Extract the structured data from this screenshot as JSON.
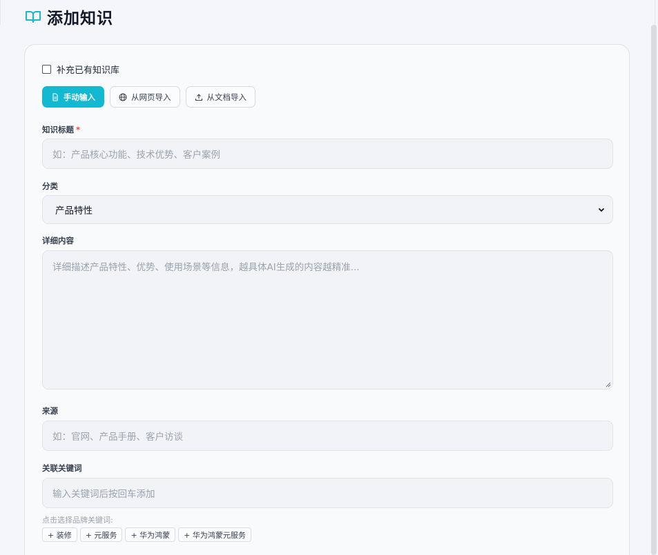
{
  "header": {
    "title": "添加知识",
    "icon": "book-open-icon",
    "accent": "#14b8d1"
  },
  "form": {
    "supplement_label": "补充已有知识库",
    "modes": [
      {
        "label": "手动输入",
        "icon": "file-icon",
        "active": true
      },
      {
        "label": "从网页导入",
        "icon": "globe-icon",
        "active": false
      },
      {
        "label": "从文档导入",
        "icon": "upload-icon",
        "active": false
      }
    ],
    "title_label": "知识标题",
    "title_required": "*",
    "title_placeholder": "如：产品核心功能、技术优势、客户案例",
    "category_label": "分类",
    "category_value": "产品特性",
    "content_label": "详细内容",
    "content_placeholder": "详细描述产品特性、优势、使用场景等信息，越具体AI生成的内容越精准...",
    "source_label": "来源",
    "source_placeholder": "如：官网、产品手册、客户访谈",
    "keywords_label": "关联关键词",
    "keywords_placeholder": "输入关键词后按回车添加",
    "brand_hint": "点击选择品牌关键词:",
    "brand_keywords": [
      "+ 装修",
      "+ 元服务",
      "+ 华为鸿蒙",
      "+ 华为鸿蒙元服务"
    ]
  }
}
